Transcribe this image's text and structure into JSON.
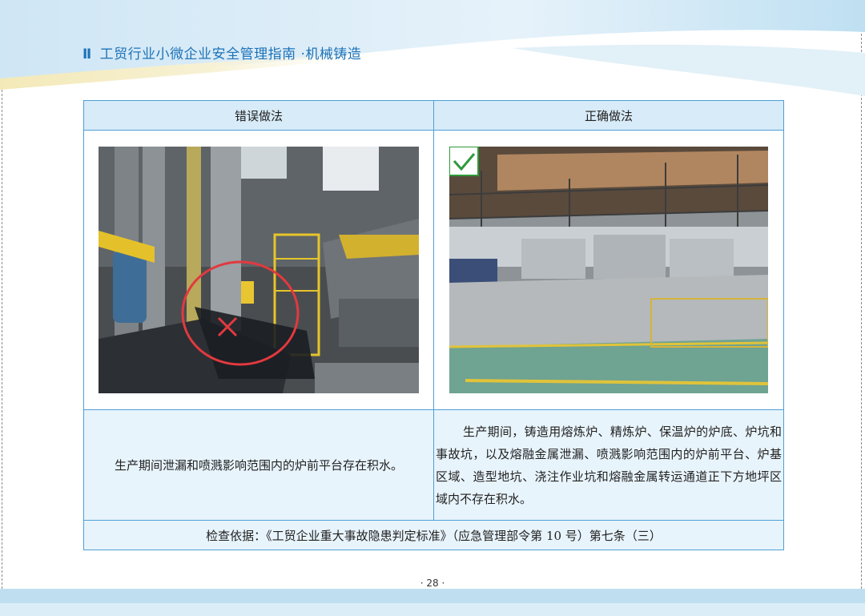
{
  "header": {
    "marker": "Ⅱ",
    "title": "工贸行业小微企业安全管理指南 ·机械铸造"
  },
  "table": {
    "wrong_header": "错误做法",
    "right_header": "正确做法",
    "wrong_description": "生产期间泄漏和喷溅影响范围内的炉前平台存在积水。",
    "right_description": "生产期间，铸造用熔炼炉、精炼炉、保温炉的炉底、炉坑和事故坑，以及熔融金属泄漏、喷溅影响范围内的炉前平台、炉基区域、造型地坑、浇注作业坑和熔融金属转运通道正下方地坪区域内不存在积水。",
    "basis": "检查依据：《工贸企业重大事故隐患判定标准》（应急管理部令第 10 号）第七条（三）"
  },
  "footer": {
    "page_number": "· 28 ·"
  },
  "icons": {
    "wrong_mark": "cross-mark-icon",
    "right_mark": "check-mark-icon"
  },
  "colors": {
    "title_blue": "#1e73b8",
    "table_border": "#4f9fd6",
    "header_fill": "#d8ebf8",
    "cell_fill": "#e8f4fc",
    "warning_red": "#e2393f",
    "check_green": "#2e9a3a"
  }
}
